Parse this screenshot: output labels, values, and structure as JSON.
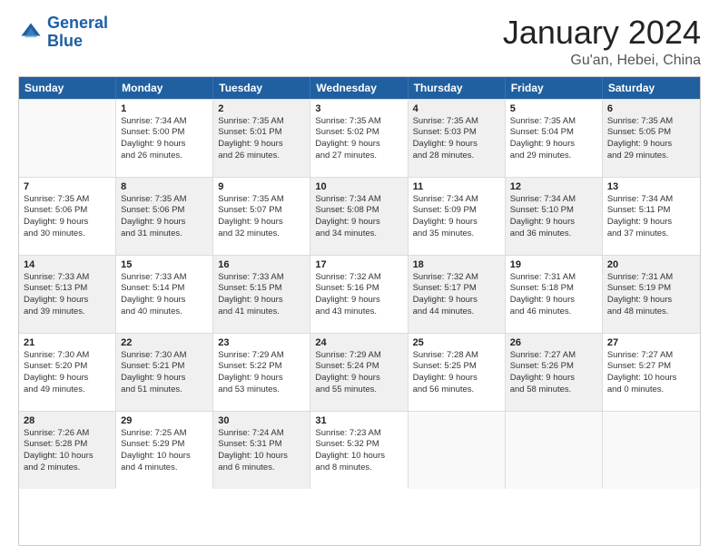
{
  "logo": {
    "text_general": "General",
    "text_blue": "Blue"
  },
  "header": {
    "month_title": "January 2024",
    "location": "Gu'an, Hebei, China"
  },
  "weekdays": [
    "Sunday",
    "Monday",
    "Tuesday",
    "Wednesday",
    "Thursday",
    "Friday",
    "Saturday"
  ],
  "rows": [
    [
      {
        "day": "",
        "lines": [],
        "shaded": false,
        "empty": true
      },
      {
        "day": "1",
        "lines": [
          "Sunrise: 7:34 AM",
          "Sunset: 5:00 PM",
          "Daylight: 9 hours",
          "and 26 minutes."
        ],
        "shaded": false
      },
      {
        "day": "2",
        "lines": [
          "Sunrise: 7:35 AM",
          "Sunset: 5:01 PM",
          "Daylight: 9 hours",
          "and 26 minutes."
        ],
        "shaded": true
      },
      {
        "day": "3",
        "lines": [
          "Sunrise: 7:35 AM",
          "Sunset: 5:02 PM",
          "Daylight: 9 hours",
          "and 27 minutes."
        ],
        "shaded": false
      },
      {
        "day": "4",
        "lines": [
          "Sunrise: 7:35 AM",
          "Sunset: 5:03 PM",
          "Daylight: 9 hours",
          "and 28 minutes."
        ],
        "shaded": true
      },
      {
        "day": "5",
        "lines": [
          "Sunrise: 7:35 AM",
          "Sunset: 5:04 PM",
          "Daylight: 9 hours",
          "and 29 minutes."
        ],
        "shaded": false
      },
      {
        "day": "6",
        "lines": [
          "Sunrise: 7:35 AM",
          "Sunset: 5:05 PM",
          "Daylight: 9 hours",
          "and 29 minutes."
        ],
        "shaded": true
      }
    ],
    [
      {
        "day": "7",
        "lines": [
          "Sunrise: 7:35 AM",
          "Sunset: 5:06 PM",
          "Daylight: 9 hours",
          "and 30 minutes."
        ],
        "shaded": false
      },
      {
        "day": "8",
        "lines": [
          "Sunrise: 7:35 AM",
          "Sunset: 5:06 PM",
          "Daylight: 9 hours",
          "and 31 minutes."
        ],
        "shaded": true
      },
      {
        "day": "9",
        "lines": [
          "Sunrise: 7:35 AM",
          "Sunset: 5:07 PM",
          "Daylight: 9 hours",
          "and 32 minutes."
        ],
        "shaded": false
      },
      {
        "day": "10",
        "lines": [
          "Sunrise: 7:34 AM",
          "Sunset: 5:08 PM",
          "Daylight: 9 hours",
          "and 34 minutes."
        ],
        "shaded": true
      },
      {
        "day": "11",
        "lines": [
          "Sunrise: 7:34 AM",
          "Sunset: 5:09 PM",
          "Daylight: 9 hours",
          "and 35 minutes."
        ],
        "shaded": false
      },
      {
        "day": "12",
        "lines": [
          "Sunrise: 7:34 AM",
          "Sunset: 5:10 PM",
          "Daylight: 9 hours",
          "and 36 minutes."
        ],
        "shaded": true
      },
      {
        "day": "13",
        "lines": [
          "Sunrise: 7:34 AM",
          "Sunset: 5:11 PM",
          "Daylight: 9 hours",
          "and 37 minutes."
        ],
        "shaded": false
      }
    ],
    [
      {
        "day": "14",
        "lines": [
          "Sunrise: 7:33 AM",
          "Sunset: 5:13 PM",
          "Daylight: 9 hours",
          "and 39 minutes."
        ],
        "shaded": true
      },
      {
        "day": "15",
        "lines": [
          "Sunrise: 7:33 AM",
          "Sunset: 5:14 PM",
          "Daylight: 9 hours",
          "and 40 minutes."
        ],
        "shaded": false
      },
      {
        "day": "16",
        "lines": [
          "Sunrise: 7:33 AM",
          "Sunset: 5:15 PM",
          "Daylight: 9 hours",
          "and 41 minutes."
        ],
        "shaded": true
      },
      {
        "day": "17",
        "lines": [
          "Sunrise: 7:32 AM",
          "Sunset: 5:16 PM",
          "Daylight: 9 hours",
          "and 43 minutes."
        ],
        "shaded": false
      },
      {
        "day": "18",
        "lines": [
          "Sunrise: 7:32 AM",
          "Sunset: 5:17 PM",
          "Daylight: 9 hours",
          "and 44 minutes."
        ],
        "shaded": true
      },
      {
        "day": "19",
        "lines": [
          "Sunrise: 7:31 AM",
          "Sunset: 5:18 PM",
          "Daylight: 9 hours",
          "and 46 minutes."
        ],
        "shaded": false
      },
      {
        "day": "20",
        "lines": [
          "Sunrise: 7:31 AM",
          "Sunset: 5:19 PM",
          "Daylight: 9 hours",
          "and 48 minutes."
        ],
        "shaded": true
      }
    ],
    [
      {
        "day": "21",
        "lines": [
          "Sunrise: 7:30 AM",
          "Sunset: 5:20 PM",
          "Daylight: 9 hours",
          "and 49 minutes."
        ],
        "shaded": false
      },
      {
        "day": "22",
        "lines": [
          "Sunrise: 7:30 AM",
          "Sunset: 5:21 PM",
          "Daylight: 9 hours",
          "and 51 minutes."
        ],
        "shaded": true
      },
      {
        "day": "23",
        "lines": [
          "Sunrise: 7:29 AM",
          "Sunset: 5:22 PM",
          "Daylight: 9 hours",
          "and 53 minutes."
        ],
        "shaded": false
      },
      {
        "day": "24",
        "lines": [
          "Sunrise: 7:29 AM",
          "Sunset: 5:24 PM",
          "Daylight: 9 hours",
          "and 55 minutes."
        ],
        "shaded": true
      },
      {
        "day": "25",
        "lines": [
          "Sunrise: 7:28 AM",
          "Sunset: 5:25 PM",
          "Daylight: 9 hours",
          "and 56 minutes."
        ],
        "shaded": false
      },
      {
        "day": "26",
        "lines": [
          "Sunrise: 7:27 AM",
          "Sunset: 5:26 PM",
          "Daylight: 9 hours",
          "and 58 minutes."
        ],
        "shaded": true
      },
      {
        "day": "27",
        "lines": [
          "Sunrise: 7:27 AM",
          "Sunset: 5:27 PM",
          "Daylight: 10 hours",
          "and 0 minutes."
        ],
        "shaded": false
      }
    ],
    [
      {
        "day": "28",
        "lines": [
          "Sunrise: 7:26 AM",
          "Sunset: 5:28 PM",
          "Daylight: 10 hours",
          "and 2 minutes."
        ],
        "shaded": true
      },
      {
        "day": "29",
        "lines": [
          "Sunrise: 7:25 AM",
          "Sunset: 5:29 PM",
          "Daylight: 10 hours",
          "and 4 minutes."
        ],
        "shaded": false
      },
      {
        "day": "30",
        "lines": [
          "Sunrise: 7:24 AM",
          "Sunset: 5:31 PM",
          "Daylight: 10 hours",
          "and 6 minutes."
        ],
        "shaded": true
      },
      {
        "day": "31",
        "lines": [
          "Sunrise: 7:23 AM",
          "Sunset: 5:32 PM",
          "Daylight: 10 hours",
          "and 8 minutes."
        ],
        "shaded": false
      },
      {
        "day": "",
        "lines": [],
        "shaded": false,
        "empty": true
      },
      {
        "day": "",
        "lines": [],
        "shaded": false,
        "empty": true
      },
      {
        "day": "",
        "lines": [],
        "shaded": false,
        "empty": true
      }
    ]
  ]
}
